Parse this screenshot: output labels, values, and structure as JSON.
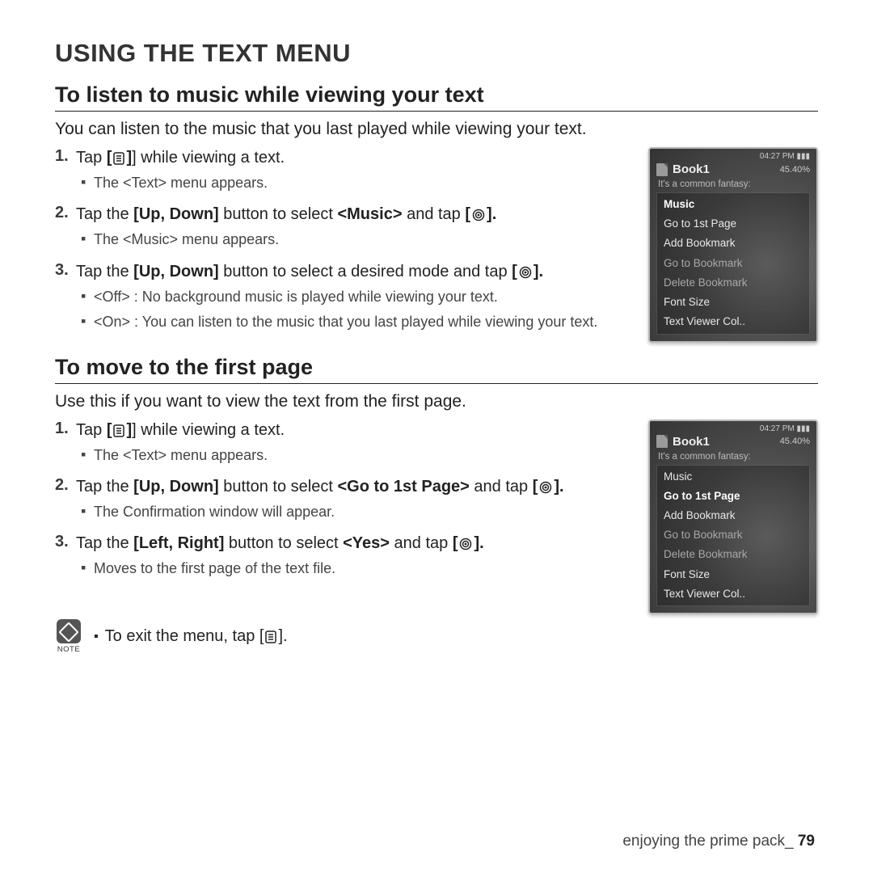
{
  "title": "USING THE TEXT MENU",
  "section1": {
    "heading": "To listen to music while viewing your text",
    "intro": "You can listen to the music that you last played while viewing your text.",
    "steps": [
      {
        "num": "1.",
        "text_before": "Tap ",
        "text_bold": "[",
        "text_after": "] while viewing a text.",
        "icon": "menu",
        "subs": [
          {
            "text": "The <Text> menu appears."
          }
        ]
      },
      {
        "num": "2.",
        "text_full_a": "Tap the ",
        "text_bold_a": "[Up, Down]",
        "text_full_b": " button to select ",
        "text_bold_b": "<Music>",
        "text_full_c": " and tap ",
        "text_bold_c": "[",
        "text_full_d": "].",
        "icon": "target",
        "subs": [
          {
            "text": "The <Music> menu appears."
          }
        ]
      },
      {
        "num": "3.",
        "text_full_a": "Tap the ",
        "text_bold_a": "[Up, Down]",
        "text_full_b": " button to select a desired mode and tap ",
        "text_bold_b": "[",
        "text_full_c": "].",
        "icon": "target",
        "subs": [
          {
            "text": "<Off> : No background music is played while viewing your text."
          },
          {
            "text": "<On> : You can listen to the music that you last played while viewing your text."
          }
        ]
      }
    ]
  },
  "section2": {
    "heading": "To move to the first page",
    "intro": "Use this if you want to view the text from the first page.",
    "steps": [
      {
        "num": "1.",
        "text_before": "Tap ",
        "text_bold": "[",
        "text_after": "] while viewing a text.",
        "icon": "menu",
        "subs": [
          {
            "text": "The <Text> menu appears."
          }
        ]
      },
      {
        "num": "2.",
        "text_full_a": "Tap the ",
        "text_bold_a": "[Up, Down]",
        "text_full_b": " button to select ",
        "text_bold_b": "<Go to 1st Page>",
        "text_full_c": " and tap ",
        "text_bold_c": "[",
        "text_full_d": "].",
        "icon": "target",
        "subs": [
          {
            "text": "The Confirmation window will appear."
          }
        ]
      },
      {
        "num": "3.",
        "text_full_a": "Tap the ",
        "text_bold_a": "[Left, Right]",
        "text_full_b": " button to select ",
        "text_bold_b": "<Yes>",
        "text_full_c": " and tap ",
        "text_bold_c": "[",
        "text_full_d": "].",
        "icon": "target",
        "subs": [
          {
            "text": "Moves to the first page of the text file."
          }
        ]
      }
    ]
  },
  "device": {
    "time": "04:27 PM",
    "batt": "▮▮▮",
    "title": "Book1",
    "percent": "45.40%",
    "fantasy": "It's a common fantasy:",
    "menu": [
      {
        "label": "Music",
        "enabled": true
      },
      {
        "label": "Go to 1st Page",
        "enabled": true
      },
      {
        "label": "Add Bookmark",
        "enabled": true
      },
      {
        "label": "Go to Bookmark",
        "enabled": false
      },
      {
        "label": "Delete Bookmark",
        "enabled": false
      },
      {
        "label": "Font Size",
        "enabled": true
      },
      {
        "label": "Text Viewer Col..",
        "enabled": true
      }
    ],
    "selected1": "Music",
    "selected2": "Go to 1st Page"
  },
  "note": {
    "caption": "NOTE",
    "text_a": "To exit the menu, tap [",
    "text_b": "]."
  },
  "footer": {
    "section": "enjoying the prime pack_ ",
    "page": "79"
  }
}
